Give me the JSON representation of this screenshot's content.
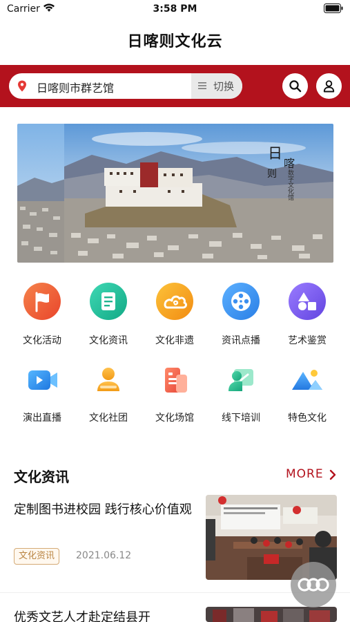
{
  "status_bar": {
    "carrier": "Carrier",
    "time": "3:58 PM"
  },
  "app": {
    "title": "日喀则文化云"
  },
  "header": {
    "location": "日喀则市群艺馆",
    "switch_label": "切换"
  },
  "banner": {
    "calligraphy_1": "日",
    "calligraphy_2": "喀",
    "calligraphy_3": "则",
    "vertical_text": "数字文化馆"
  },
  "grid": [
    {
      "label": "文化活动",
      "icon": "flag-icon",
      "color": "#ef5a2a"
    },
    {
      "label": "文化资讯",
      "icon": "document-icon",
      "color": "#22c3a0"
    },
    {
      "label": "文化非遗",
      "icon": "cloud-pattern-icon",
      "color": "#f5a51b"
    },
    {
      "label": "资讯点播",
      "icon": "film-reel-icon",
      "color": "#3b8ff0"
    },
    {
      "label": "艺术鉴赏",
      "icon": "shapes-icon",
      "color": "#7a5cf0"
    },
    {
      "label": "演出直播",
      "icon": "video-camera-icon",
      "color": "#2d8cf0"
    },
    {
      "label": "文化社团",
      "icon": "group-person-icon",
      "color": "#f5a623"
    },
    {
      "label": "文化场馆",
      "icon": "venue-building-icon",
      "color": "#ee5a4a"
    },
    {
      "label": "线下培训",
      "icon": "training-board-icon",
      "color": "#1dbb8e"
    },
    {
      "label": "特色文化",
      "icon": "mountain-icon",
      "color": "#3a8ef0"
    }
  ],
  "section": {
    "title": "文化资讯",
    "more": "MORE"
  },
  "news": [
    {
      "title": "定制图书进校园 践行核心价值观",
      "tag": "文化资讯",
      "date": "2021.06.12"
    },
    {
      "title": "优秀文艺人才赴定结县开"
    }
  ],
  "colors": {
    "brand_red": "#b3121d",
    "tag_gold": "#b98442"
  }
}
